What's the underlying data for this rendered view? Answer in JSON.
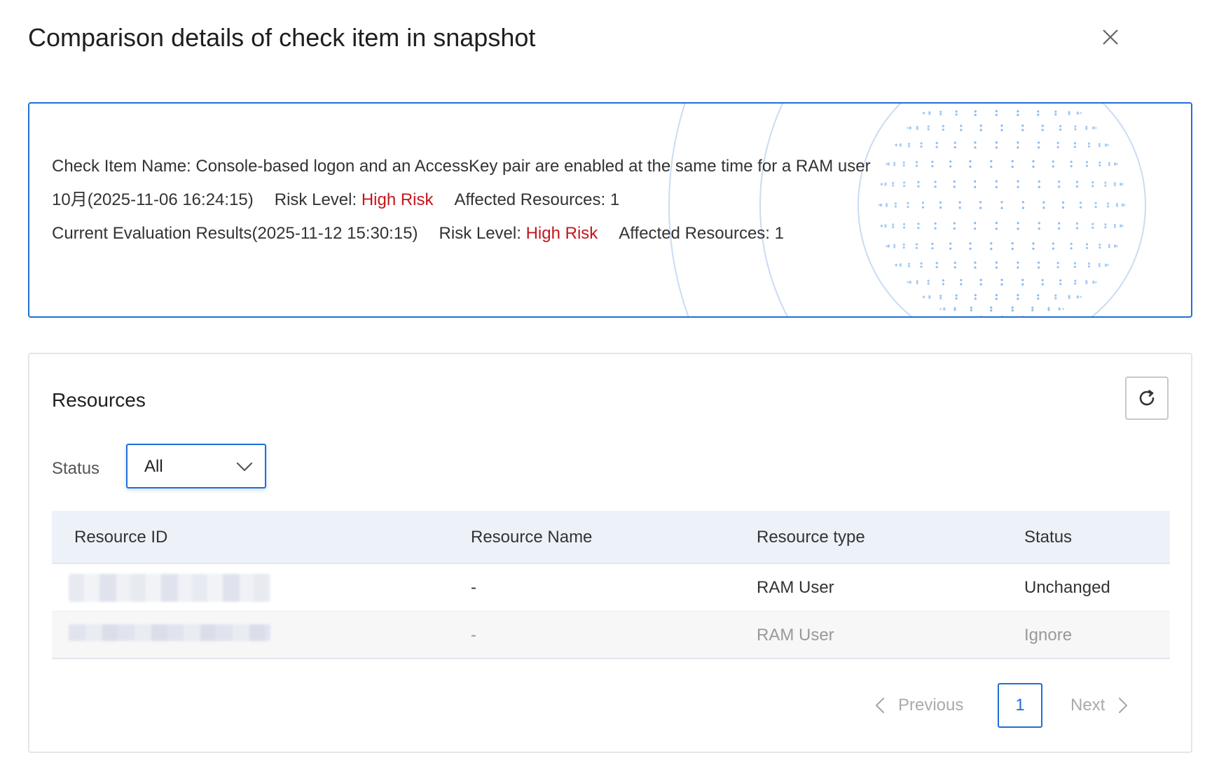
{
  "dialog": {
    "title": "Comparison details of check item in snapshot",
    "close_icon": "close-icon"
  },
  "summary": {
    "check_item_label": "Check Item Name: Console-based logon and an AccessKey pair are enabled at the same time for a RAM user",
    "snapshot": {
      "label": "10月(2025-11-06 16:24:15)",
      "risk_prefix": "Risk Level: ",
      "risk_value": "High Risk",
      "affected": "Affected Resources: 1"
    },
    "current": {
      "label": "Current Evaluation Results(2025-11-12 15:30:15)",
      "risk_prefix": "Risk Level: ",
      "risk_value": "High Risk",
      "affected": "Affected Resources: 1"
    },
    "colors": {
      "border": "#1f6fd6",
      "risk": "#c4161c",
      "globe": "#7fb4ef"
    }
  },
  "resources": {
    "title": "Resources",
    "refresh_icon": "refresh-icon",
    "filter": {
      "label": "Status",
      "selected": "All",
      "icon": "chevron-down-icon"
    },
    "table": {
      "columns": [
        "Resource ID",
        "Resource Name",
        "Resource type",
        "Status"
      ],
      "rows": [
        {
          "id": "",
          "name": "-",
          "type": "RAM User",
          "status": "Unchanged"
        },
        {
          "id": "",
          "name": "-",
          "type": "RAM User",
          "status": "Ignore"
        }
      ]
    },
    "pagination": {
      "previous": "Previous",
      "current_page": "1",
      "next": "Next"
    }
  }
}
